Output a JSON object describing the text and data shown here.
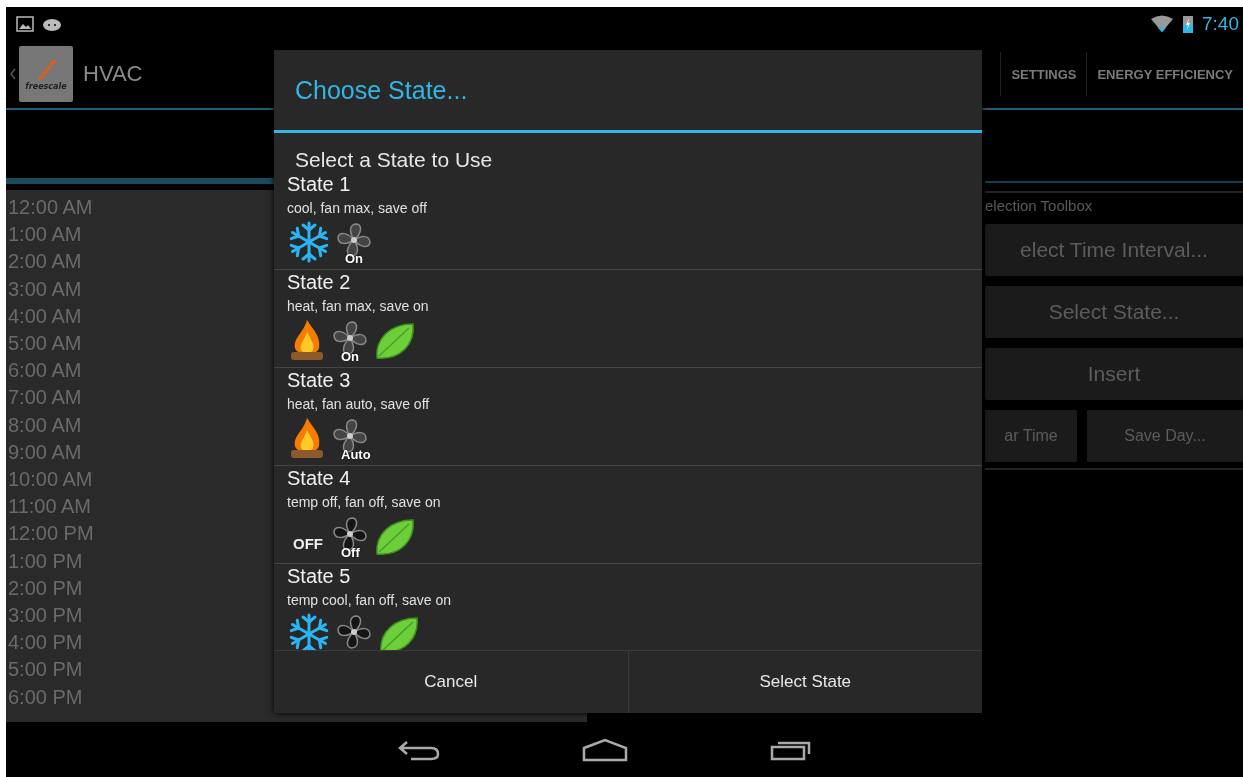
{
  "status_bar": {
    "time": "7:40"
  },
  "action_bar": {
    "logo_text": "freescale",
    "title": "HVAC",
    "tabs": [
      {
        "label": "SETTINGS",
        "selected": false
      },
      {
        "label": "ENERGY EFFICIENCY",
        "selected": false
      }
    ]
  },
  "time_list": [
    "12:00 AM",
    "1:00 AM",
    "2:00 AM",
    "3:00 AM",
    "4:00 AM",
    "5:00 AM",
    "6:00 AM",
    "7:00 AM",
    "8:00 AM",
    "9:00 AM",
    "10:00 AM",
    "11:00 AM",
    "12:00 PM",
    "1:00 PM",
    "2:00 PM",
    "3:00 PM",
    "4:00 PM",
    "5:00 PM",
    "6:00 PM"
  ],
  "toolbox": {
    "title": "election Toolbox",
    "buttons": [
      "elect Time Interval...",
      "Select State...",
      "Insert"
    ],
    "bottom_buttons": [
      "ar Time",
      "Save Day..."
    ]
  },
  "dialog": {
    "title": "Choose State...",
    "subtitle": "Select a State to Use",
    "states": [
      {
        "name": "State 1",
        "description": "cool, fan max, save off",
        "icons": [
          {
            "kind": "snow"
          },
          {
            "kind": "fan",
            "label": "On"
          }
        ]
      },
      {
        "name": "State 2",
        "description": "heat, fan max, save on",
        "icons": [
          {
            "kind": "fire"
          },
          {
            "kind": "fan",
            "label": "On"
          },
          {
            "kind": "leaf"
          }
        ]
      },
      {
        "name": "State 3",
        "description": "heat, fan auto, save off",
        "icons": [
          {
            "kind": "fire"
          },
          {
            "kind": "fan",
            "label": "Auto"
          }
        ]
      },
      {
        "name": "State 4",
        "description": "temp off, fan off, save on",
        "icons": [
          {
            "kind": "off",
            "label": "OFF"
          },
          {
            "kind": "fan-off",
            "label": "Off"
          },
          {
            "kind": "leaf"
          }
        ]
      },
      {
        "name": "State 5",
        "description": "temp cool, fan off, save on",
        "icons": [
          {
            "kind": "snow"
          },
          {
            "kind": "fan-off"
          },
          {
            "kind": "leaf"
          }
        ]
      }
    ],
    "buttons": [
      "Cancel",
      "Select State"
    ]
  }
}
